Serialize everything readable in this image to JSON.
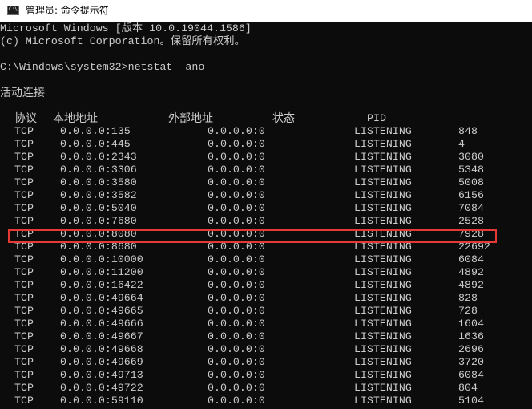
{
  "window": {
    "title": "管理员: 命令提示符",
    "icon": "cmd-icon",
    "icon_text": "C:\\"
  },
  "console": {
    "banner_line1": "Microsoft Windows [版本 10.0.19044.1586]",
    "banner_line2": "(c) Microsoft Corporation。保留所有权利。",
    "prompt": "C:\\Windows\\system32>netstat -ano",
    "section_title": "活动连接",
    "headers": {
      "proto": "协议",
      "local": "本地地址",
      "foreign": "外部地址",
      "state": "状态",
      "pid": "PID"
    },
    "rows": [
      {
        "proto": "TCP",
        "local": "0.0.0.0:135",
        "foreign": "0.0.0.0:0",
        "state": "LISTENING",
        "pid": "848"
      },
      {
        "proto": "TCP",
        "local": "0.0.0.0:445",
        "foreign": "0.0.0.0:0",
        "state": "LISTENING",
        "pid": "4"
      },
      {
        "proto": "TCP",
        "local": "0.0.0.0:2343",
        "foreign": "0.0.0.0:0",
        "state": "LISTENING",
        "pid": "3080"
      },
      {
        "proto": "TCP",
        "local": "0.0.0.0:3306",
        "foreign": "0.0.0.0:0",
        "state": "LISTENING",
        "pid": "5348"
      },
      {
        "proto": "TCP",
        "local": "0.0.0.0:3580",
        "foreign": "0.0.0.0:0",
        "state": "LISTENING",
        "pid": "5008"
      },
      {
        "proto": "TCP",
        "local": "0.0.0.0:3582",
        "foreign": "0.0.0.0:0",
        "state": "LISTENING",
        "pid": "6156"
      },
      {
        "proto": "TCP",
        "local": "0.0.0.0:5040",
        "foreign": "0.0.0.0:0",
        "state": "LISTENING",
        "pid": "7084"
      },
      {
        "proto": "TCP",
        "local": "0.0.0.0:7680",
        "foreign": "0.0.0.0:0",
        "state": "LISTENING",
        "pid": "2528"
      },
      {
        "proto": "TCP",
        "local": "0.0.0.0:8080",
        "foreign": "0.0.0.0:0",
        "state": "LISTENING",
        "pid": "7928",
        "highlighted": true
      },
      {
        "proto": "TCP",
        "local": "0.0.0.0:8680",
        "foreign": "0.0.0.0:0",
        "state": "LISTENING",
        "pid": "22692"
      },
      {
        "proto": "TCP",
        "local": "0.0.0.0:10000",
        "foreign": "0.0.0.0:0",
        "state": "LISTENING",
        "pid": "6084"
      },
      {
        "proto": "TCP",
        "local": "0.0.0.0:11200",
        "foreign": "0.0.0.0:0",
        "state": "LISTENING",
        "pid": "4892"
      },
      {
        "proto": "TCP",
        "local": "0.0.0.0:16422",
        "foreign": "0.0.0.0:0",
        "state": "LISTENING",
        "pid": "4892"
      },
      {
        "proto": "TCP",
        "local": "0.0.0.0:49664",
        "foreign": "0.0.0.0:0",
        "state": "LISTENING",
        "pid": "828"
      },
      {
        "proto": "TCP",
        "local": "0.0.0.0:49665",
        "foreign": "0.0.0.0:0",
        "state": "LISTENING",
        "pid": "728"
      },
      {
        "proto": "TCP",
        "local": "0.0.0.0:49666",
        "foreign": "0.0.0.0:0",
        "state": "LISTENING",
        "pid": "1604"
      },
      {
        "proto": "TCP",
        "local": "0.0.0.0:49667",
        "foreign": "0.0.0.0:0",
        "state": "LISTENING",
        "pid": "1636"
      },
      {
        "proto": "TCP",
        "local": "0.0.0.0:49668",
        "foreign": "0.0.0.0:0",
        "state": "LISTENING",
        "pid": "2696"
      },
      {
        "proto": "TCP",
        "local": "0.0.0.0:49669",
        "foreign": "0.0.0.0:0",
        "state": "LISTENING",
        "pid": "3720"
      },
      {
        "proto": "TCP",
        "local": "0.0.0.0:49713",
        "foreign": "0.0.0.0:0",
        "state": "LISTENING",
        "pid": "6084"
      },
      {
        "proto": "TCP",
        "local": "0.0.0.0:49722",
        "foreign": "0.0.0.0:0",
        "state": "LISTENING",
        "pid": "804"
      },
      {
        "proto": "TCP",
        "local": "0.0.0.0:59110",
        "foreign": "0.0.0.0:0",
        "state": "LISTENING",
        "pid": "5104"
      }
    ]
  },
  "colors": {
    "console_bg": "#0c0c0c",
    "console_fg": "#cccccc",
    "highlight": "#e53935"
  }
}
